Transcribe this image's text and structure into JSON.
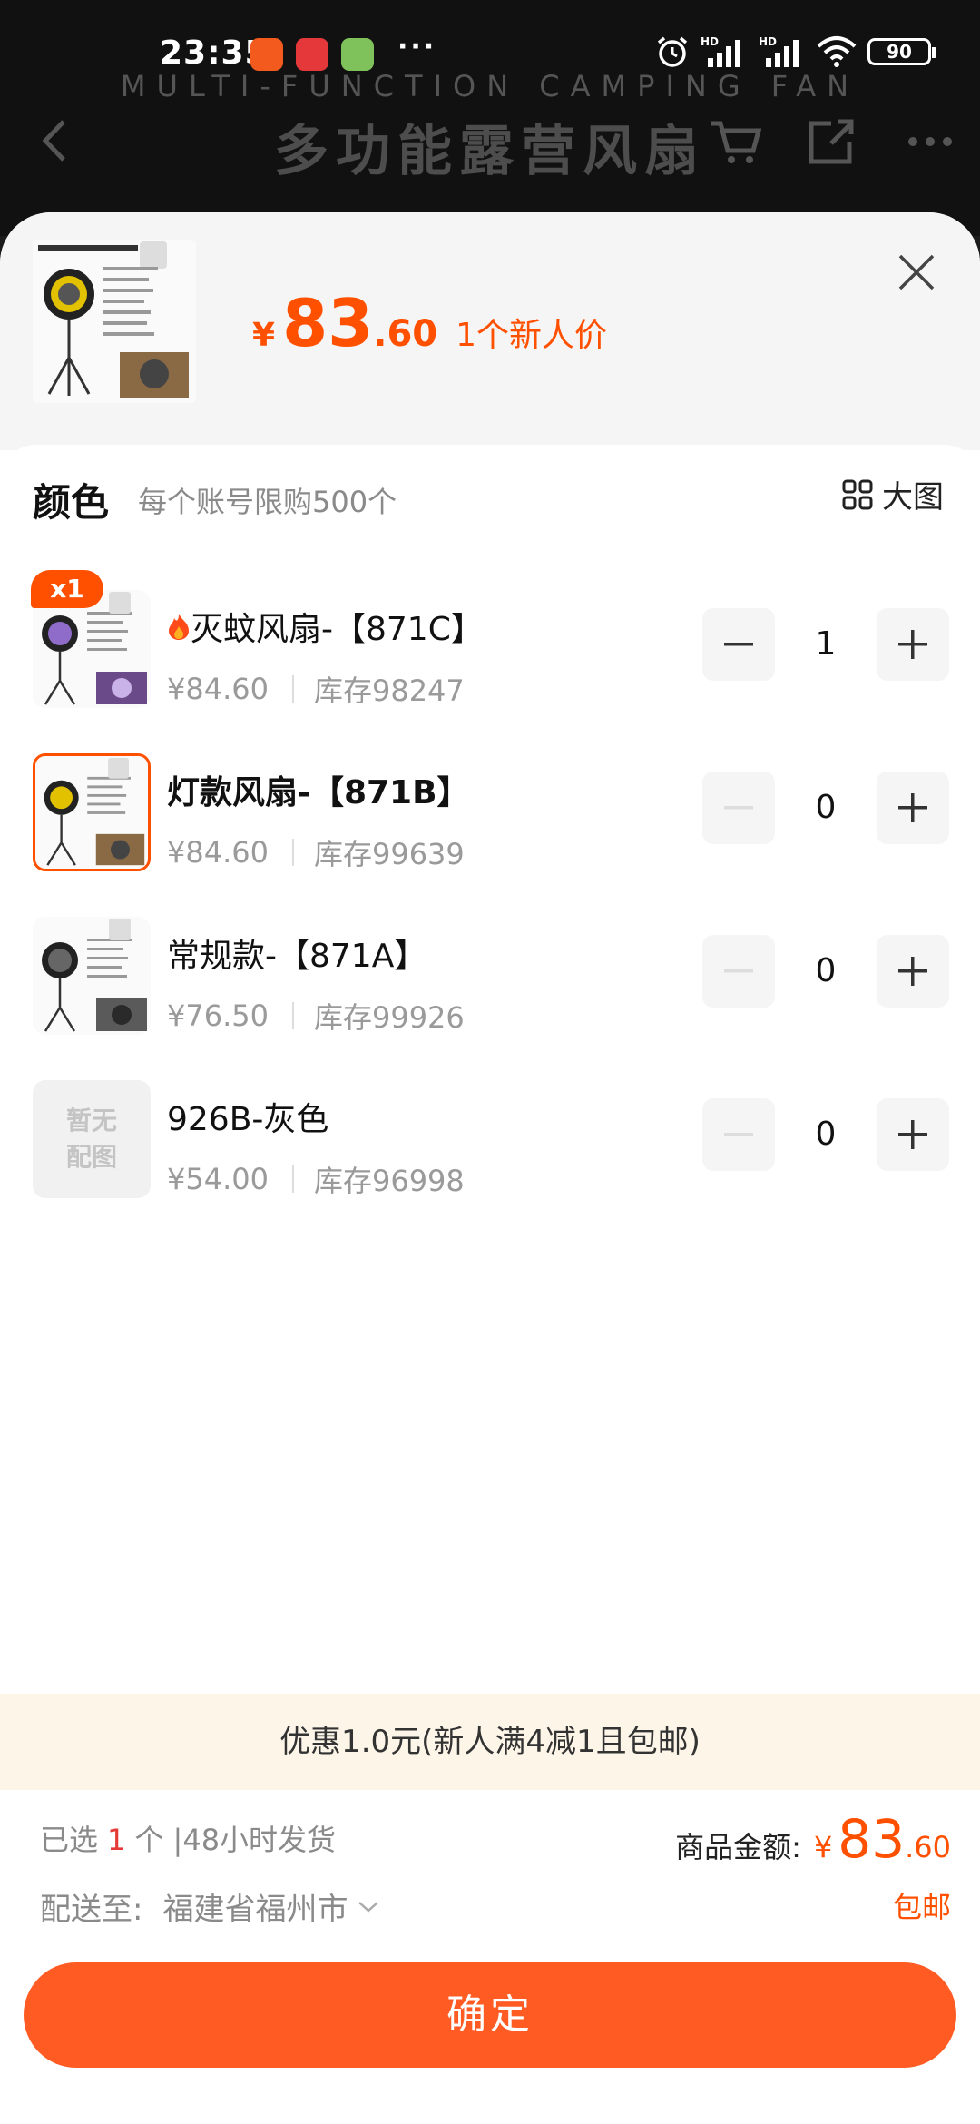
{
  "status_bar": {
    "time": "23:35",
    "battery": "90"
  },
  "background_page": {
    "subtitle": "MULTI-FUNCTION CAMPING FAN",
    "title": "多功能露营风扇"
  },
  "header": {
    "price_symbol": "¥",
    "price_int": "83",
    "price_dec": ".60",
    "price_note": "1个新人价"
  },
  "section": {
    "title": "颜色",
    "limit": "每个账号限购500个",
    "big_image_label": "大图"
  },
  "skus": [
    {
      "badge": "x1",
      "name": "灭蚊风扇-【871C】",
      "price": "¥84.60",
      "stock": "库存98247",
      "qty": "1"
    },
    {
      "name": "灯款风扇-【871B】",
      "price": "¥84.60",
      "stock": "库存99639",
      "qty": "0"
    },
    {
      "name": "常规款-【871A】",
      "price": "¥76.50",
      "stock": "库存99926",
      "qty": "0"
    },
    {
      "placeholder": "暂无\n配图",
      "name": "926B-灰色",
      "price": "¥54.00",
      "stock": "库存96998",
      "qty": "0"
    }
  ],
  "promo": "优惠1.0元(新人满4减1且包邮)",
  "footer": {
    "selected_prefix": "已选",
    "selected_count": "1",
    "selected_suffix": "个 |48小时发货",
    "amount_label": "商品金额:",
    "amount_symbol": "¥",
    "amount_int": "83",
    "amount_dec": ".60",
    "ship_label": "配送至:",
    "ship_city": "福建省福州市",
    "free_shipping": "包邮",
    "confirm": "确定"
  },
  "colors": {
    "accent": "#ff5000",
    "button": "#ff5b23",
    "promo_bg": "#fdf6e8"
  }
}
